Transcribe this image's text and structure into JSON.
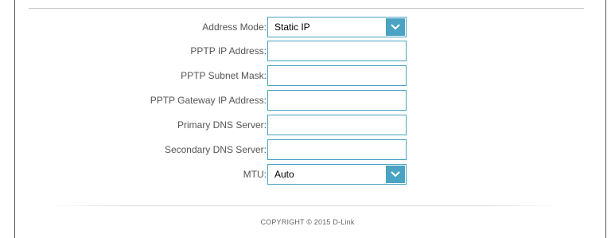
{
  "form": {
    "address_mode": {
      "label": "Address Mode:",
      "value": "Static IP"
    },
    "pptp_ip_address": {
      "label": "PPTP IP Address:",
      "value": ""
    },
    "pptp_subnet_mask": {
      "label": "PPTP Subnet Mask:",
      "value": ""
    },
    "pptp_gateway_ip_address": {
      "label": "PPTP Gateway IP Address:",
      "value": ""
    },
    "primary_dns_server": {
      "label": "Primary DNS Server:",
      "value": ""
    },
    "secondary_dns_server": {
      "label": "Secondary DNS Server:",
      "value": ""
    },
    "mtu": {
      "label": "MTU:",
      "value": "Auto"
    }
  },
  "footer": {
    "copyright": "COPYRIGHT © 2015 D-Link"
  },
  "colors": {
    "accent": "#4aa3c2",
    "label_text": "#555555",
    "frame_border": "#555555"
  },
  "icons": {
    "dropdown": "chevron-down-icon"
  }
}
